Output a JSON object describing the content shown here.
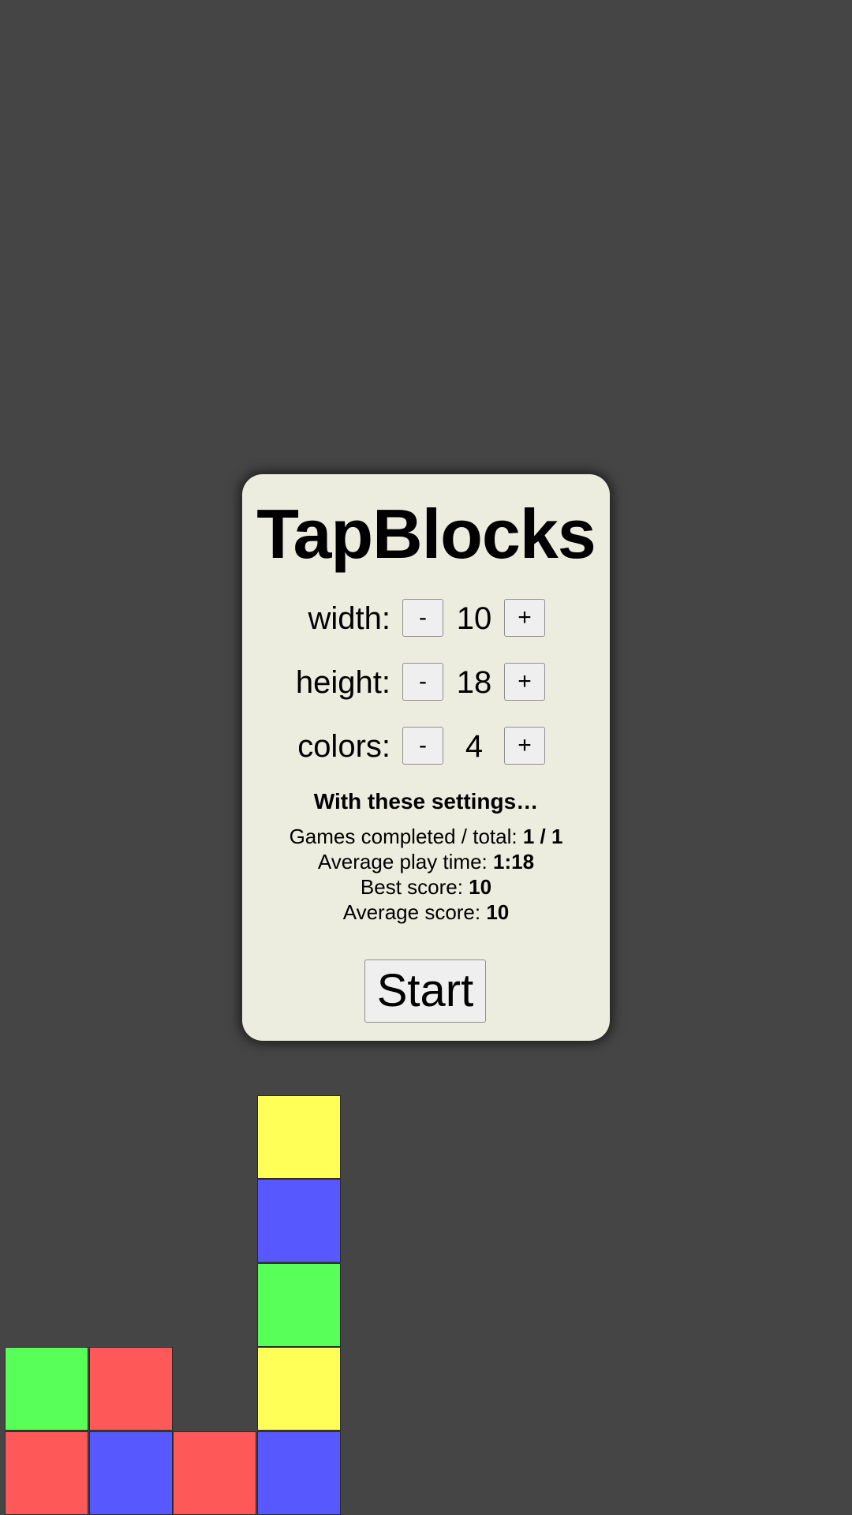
{
  "app": {
    "title": "TapBlocks"
  },
  "settings": [
    {
      "label": "width:",
      "value": "10",
      "minus_label": "-",
      "plus_label": "+"
    },
    {
      "label": "height:",
      "value": "18",
      "minus_label": "-",
      "plus_label": "+"
    },
    {
      "label": "colors:",
      "value": "4",
      "minus_label": "-",
      "plus_label": "+"
    }
  ],
  "stats": {
    "heading": "With these settings…",
    "games_label": "Games completed / total: ",
    "games_value": "1 / 1",
    "time_label": "Average play time: ",
    "time_value": "1:18",
    "best_label": "Best score: ",
    "best_value": "10",
    "avg_label": "Average score: ",
    "avg_value": "10"
  },
  "start_label": "Start",
  "colors": {
    "background": "#454545",
    "panel": "#ededdf",
    "red": "#ff5858",
    "green": "#58ff58",
    "blue": "#5858ff",
    "yellow": "#ffff58"
  },
  "board": {
    "columns": 10,
    "stacks": [
      [
        "red",
        "green"
      ],
      [
        "blue",
        "red"
      ],
      [
        "red"
      ],
      [
        "blue",
        "yellow",
        "green",
        "blue",
        "yellow"
      ]
    ]
  }
}
